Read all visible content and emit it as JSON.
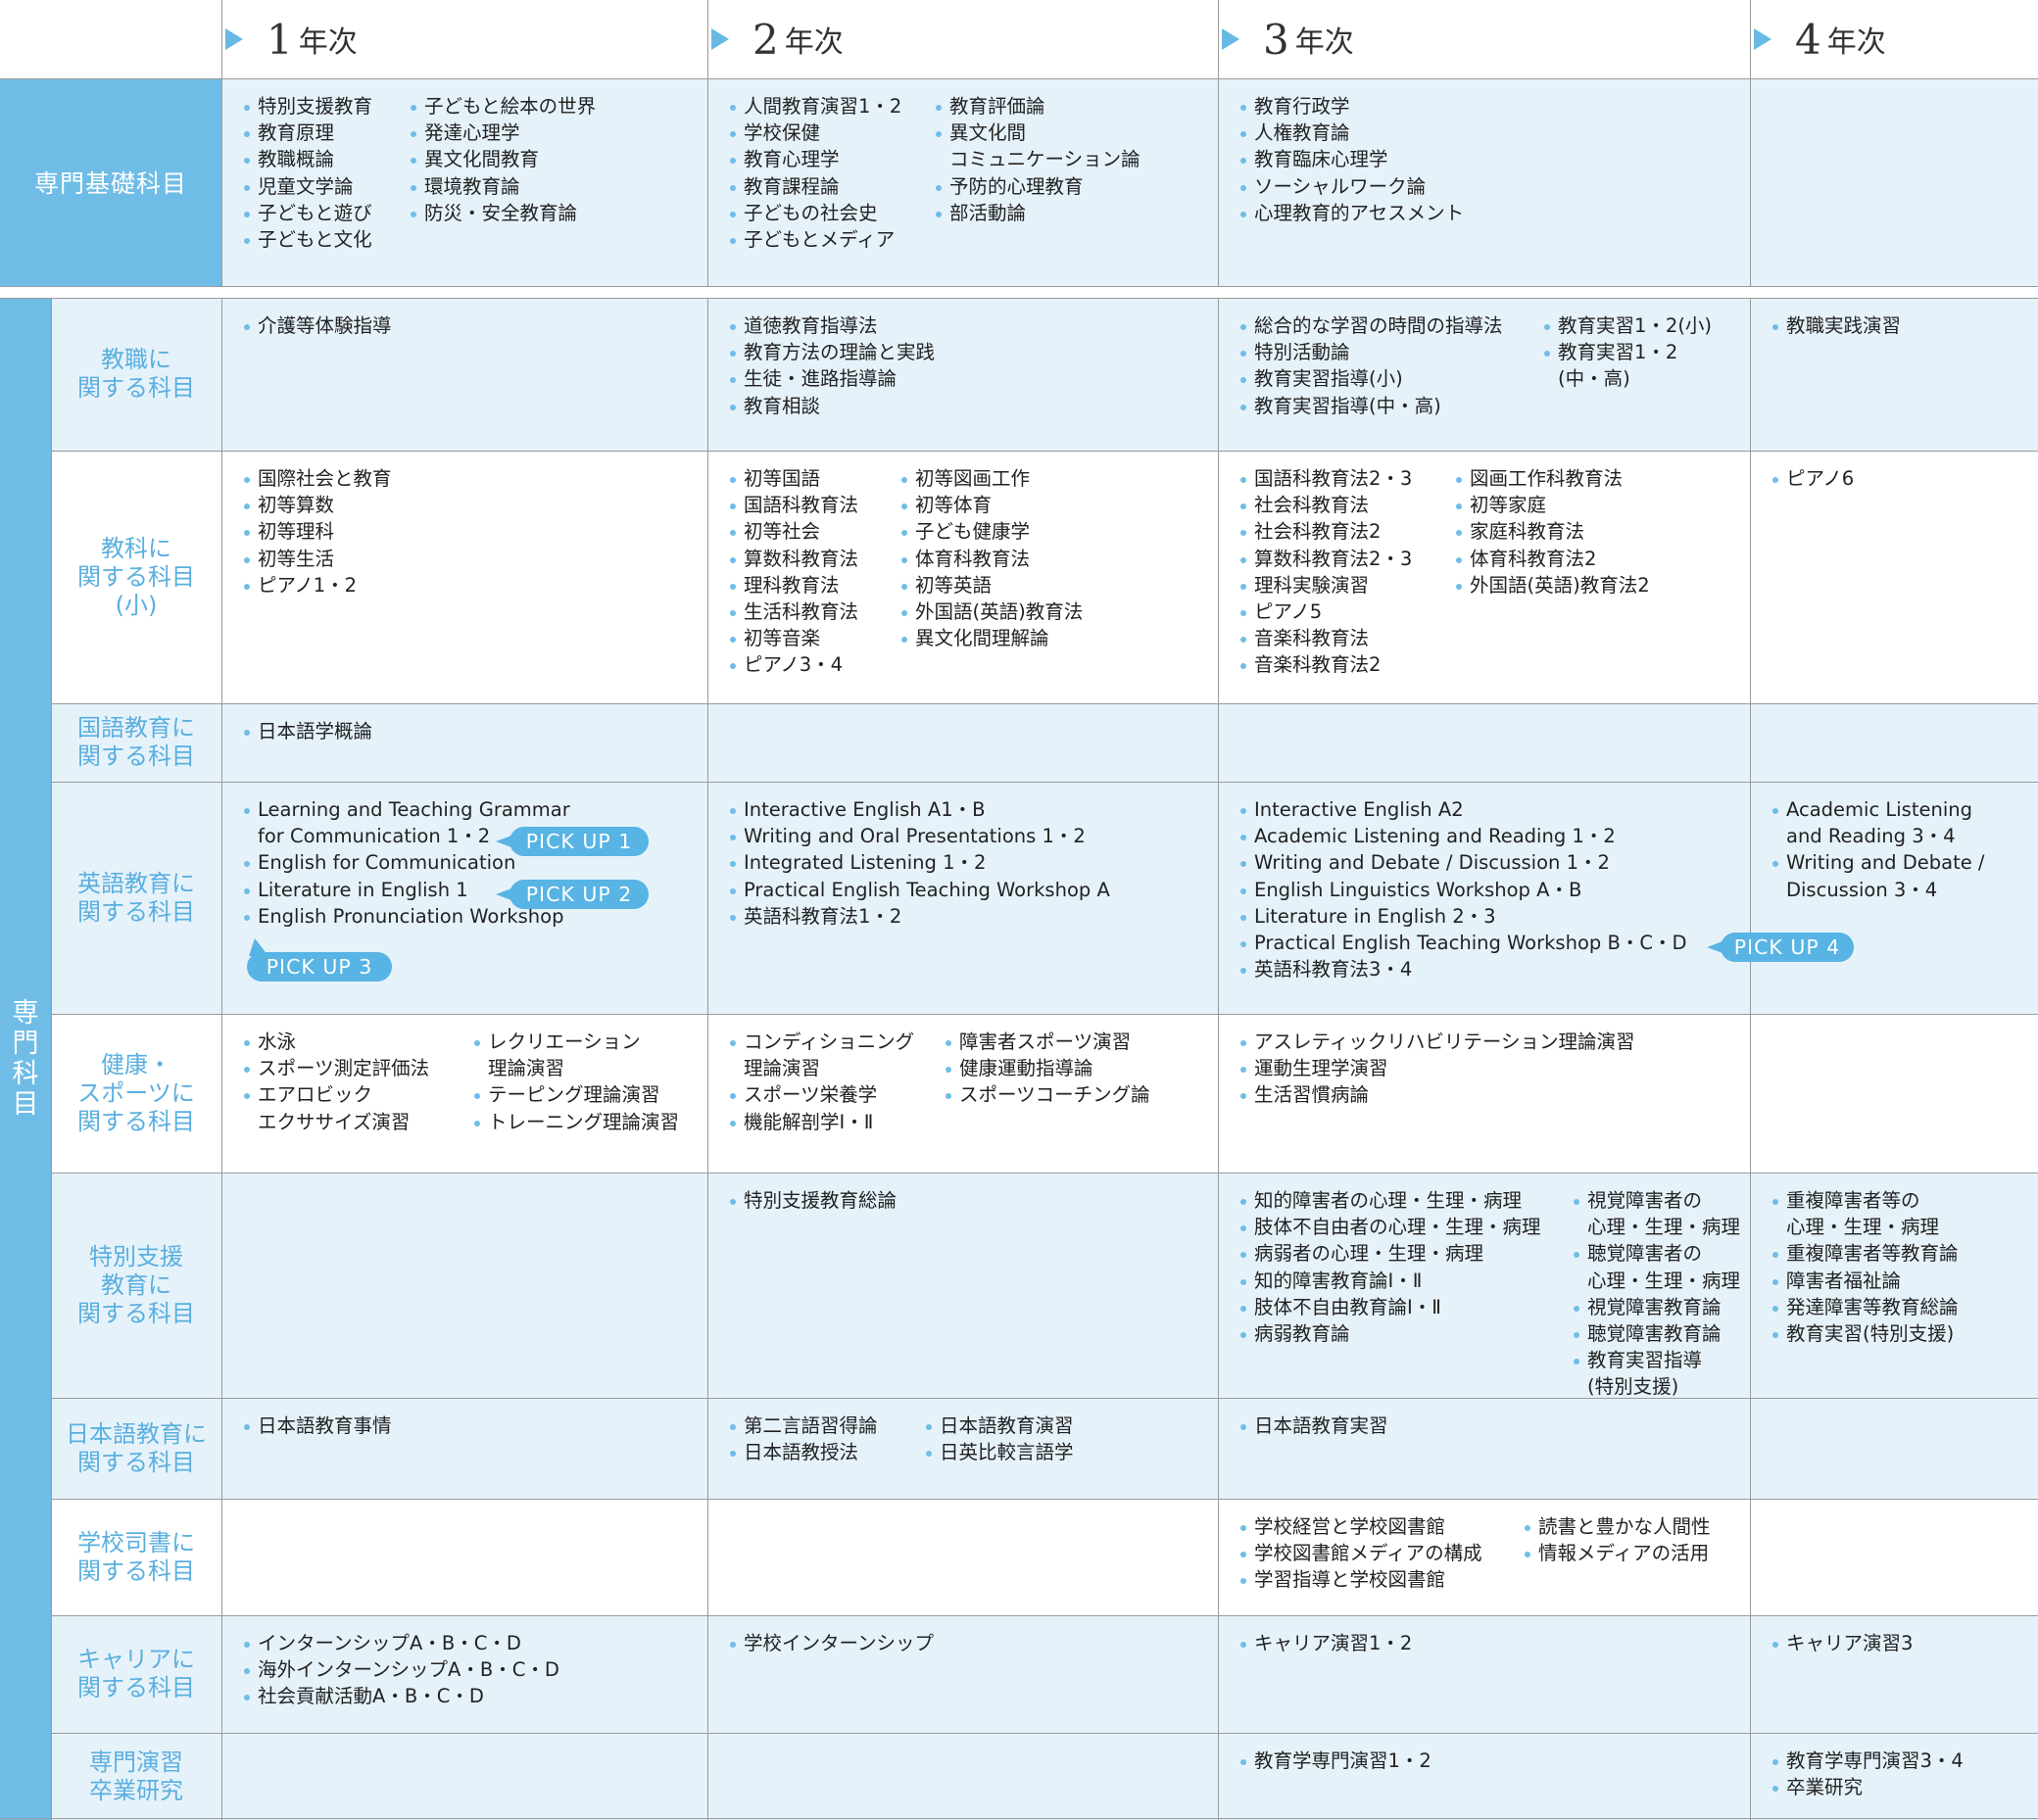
{
  "years": [
    {
      "num": "1",
      "label": "年次"
    },
    {
      "num": "2",
      "label": "年次"
    },
    {
      "num": "3",
      "label": "年次"
    },
    {
      "num": "4",
      "label": "年次"
    }
  ],
  "basic_label": "専門基礎科目",
  "side_label": [
    "専",
    "門",
    "科",
    "目"
  ],
  "basic_cells": [
    [
      [
        "特別支援教育",
        "教育原理",
        "教職概論",
        "児童文学論",
        "子どもと遊び",
        "子どもと文化"
      ],
      [
        "子どもと絵本の世界",
        "発達心理学",
        "異文化間教育",
        "環境教育論",
        "防災・安全教育論"
      ]
    ],
    [
      [
        "人間教育演習1・2",
        "学校保健",
        "教育心理学",
        "教育課程論",
        "子どもの社会史",
        "子どもとメディア"
      ],
      [
        "教育評価論",
        "異文化間",
        "コミュニケーション論",
        "予防的心理教育",
        "部活動論"
      ]
    ],
    [
      [
        "教育行政学",
        "人権教育論",
        "教育臨床心理学",
        "ソーシャルワーク論",
        "心理教育的アセスメント"
      ]
    ],
    []
  ],
  "rows": [
    {
      "label": [
        "教職に",
        "関する科目"
      ],
      "cells": [
        [
          [
            "介護等体験指導"
          ]
        ],
        [
          [
            "道徳教育指導法",
            "教育方法の理論と実践",
            "生徒・進路指導論",
            "教育相談"
          ]
        ],
        [
          [
            "総合的な学習の時間の指導法",
            "特別活動論",
            "教育実習指導(小)",
            "教育実習指導(中・高)"
          ],
          [
            "教育実習1・2(小)",
            "教育実習1・2",
            "(中・高)"
          ]
        ],
        [
          [
            "教職実践演習"
          ]
        ]
      ]
    },
    {
      "label": [
        "教科に",
        "関する科目",
        "(小)"
      ],
      "cells": [
        [
          [
            "国際社会と教育",
            "初等算数",
            "初等理科",
            "初等生活",
            "ピアノ1・2"
          ]
        ],
        [
          [
            "初等国語",
            "国語科教育法",
            "初等社会",
            "算数科教育法",
            "理科教育法",
            "生活科教育法",
            "初等音楽",
            "ピアノ3・4"
          ],
          [
            "初等図画工作",
            "初等体育",
            "子ども健康学",
            "体育科教育法",
            "初等英語",
            "外国語(英語)教育法",
            "異文化間理解論"
          ]
        ],
        [
          [
            "国語科教育法2・3",
            "社会科教育法",
            "社会科教育法2",
            "算数科教育法2・3",
            "理科実験演習",
            "ピアノ5",
            "音楽科教育法",
            "音楽科教育法2"
          ],
          [
            "図画工作科教育法",
            "初等家庭",
            "家庭科教育法",
            "体育科教育法2",
            "外国語(英語)教育法2"
          ]
        ],
        [
          [
            "ピアノ6"
          ]
        ]
      ]
    },
    {
      "label": [
        "国語教育に",
        "関する科目"
      ],
      "cells": [
        [
          [
            "日本語学概論"
          ]
        ],
        [],
        [],
        []
      ]
    },
    {
      "label": [
        "英語教育に",
        "関する科目"
      ],
      "cells": [
        [
          [
            "Learning and Teaching Grammar",
            "for Communication 1・2",
            "English for Communication",
            "Literature in English 1",
            "English Pronunciation Workshop"
          ]
        ],
        [
          [
            "Interactive English A1・B",
            "Writing and Oral Presentations 1・2",
            "Integrated Listening 1・2",
            "Practical English Teaching Workshop A",
            "英語科教育法1・2"
          ]
        ],
        [
          [
            "Interactive English A2",
            "Academic Listening and Reading 1・2",
            "Writing and Debate / Discussion 1・2",
            "English Linguistics Workshop A・B",
            "Literature in English 2・3",
            "Practical English Teaching Workshop B・C・D",
            "英語科教育法3・4"
          ]
        ],
        [
          [
            "Academic Listening",
            "and Reading 3・4",
            "Writing and Debate /",
            "Discussion 3・4"
          ]
        ]
      ]
    },
    {
      "label": [
        "健康・",
        "スポーツに",
        "関する科目"
      ],
      "cells": [
        [
          [
            "水泳",
            "スポーツ測定評価法",
            "エアロビック",
            "エクササイズ演習"
          ],
          [
            "レクリエーション",
            "理論演習",
            "テーピング理論演習",
            "トレーニング理論演習"
          ]
        ],
        [
          [
            "コンディショニング",
            "理論演習",
            "スポーツ栄養学",
            "機能解剖学Ⅰ・Ⅱ"
          ],
          [
            "障害者スポーツ演習",
            "健康運動指導論",
            "スポーツコーチング論"
          ]
        ],
        [
          [
            "アスレティックリハビリテーション理論演習",
            "運動生理学演習",
            "生活習慣病論"
          ]
        ],
        []
      ]
    },
    {
      "label": [
        "特別支援",
        "教育に",
        "関する科目"
      ],
      "cells": [
        [],
        [
          [
            "特別支援教育総論"
          ]
        ],
        [
          [
            "知的障害者の心理・生理・病理",
            "肢体不自由者の心理・生理・病理",
            "病弱者の心理・生理・病理",
            "知的障害教育論Ⅰ・Ⅱ",
            "肢体不自由教育論Ⅰ・Ⅱ",
            "病弱教育論"
          ],
          [
            "視覚障害者の",
            "心理・生理・病理",
            "聴覚障害者の",
            "心理・生理・病理",
            "視覚障害教育論",
            "聴覚障害教育論",
            "教育実習指導",
            "(特別支援)"
          ]
        ],
        [
          [
            "重複障害者等の",
            "心理・生理・病理",
            "重複障害者等教育論",
            "障害者福祉論",
            "発達障害等教育総論",
            "教育実習(特別支援)"
          ]
        ]
      ]
    },
    {
      "label": [
        "日本語教育に",
        "関する科目"
      ],
      "cells": [
        [
          [
            "日本語教育事情"
          ]
        ],
        [
          [
            "第二言語習得論",
            "日本語教授法"
          ],
          [
            "日本語教育演習",
            "日英比較言語学"
          ]
        ],
        [
          [
            "日本語教育実習"
          ]
        ],
        []
      ]
    },
    {
      "label": [
        "学校司書に",
        "関する科目"
      ],
      "cells": [
        [],
        [],
        [
          [
            "学校経営と学校図書館",
            "学校図書館メディアの構成",
            "学習指導と学校図書館"
          ],
          [
            "読書と豊かな人間性",
            "情報メディアの活用"
          ]
        ],
        []
      ]
    },
    {
      "label": [
        "キャリアに",
        "関する科目"
      ],
      "cells": [
        [
          [
            "インターンシップA・B・C・D",
            "海外インターンシップA・B・C・D",
            "社会貢献活動A・B・C・D"
          ]
        ],
        [
          [
            "学校インターンシップ"
          ]
        ],
        [
          [
            "キャリア演習1・2"
          ]
        ],
        [
          [
            "キャリア演習3"
          ]
        ]
      ]
    },
    {
      "label": [
        "専門演習",
        "卒業研究"
      ],
      "cells": [
        [],
        [],
        [
          [
            "教育学専門演習1・2"
          ]
        ],
        [
          [
            "教育学専門演習3・4",
            "卒業研究"
          ]
        ]
      ]
    }
  ],
  "pickups": [
    "PICK UP 1",
    "PICK UP 2",
    "PICK UP 3",
    "PICK UP 4"
  ],
  "colors": {
    "accent": "#6fbde6",
    "row_tint": "#e6f2fa",
    "label_text": "#5aafdf",
    "grid": "#9a9a9a"
  }
}
